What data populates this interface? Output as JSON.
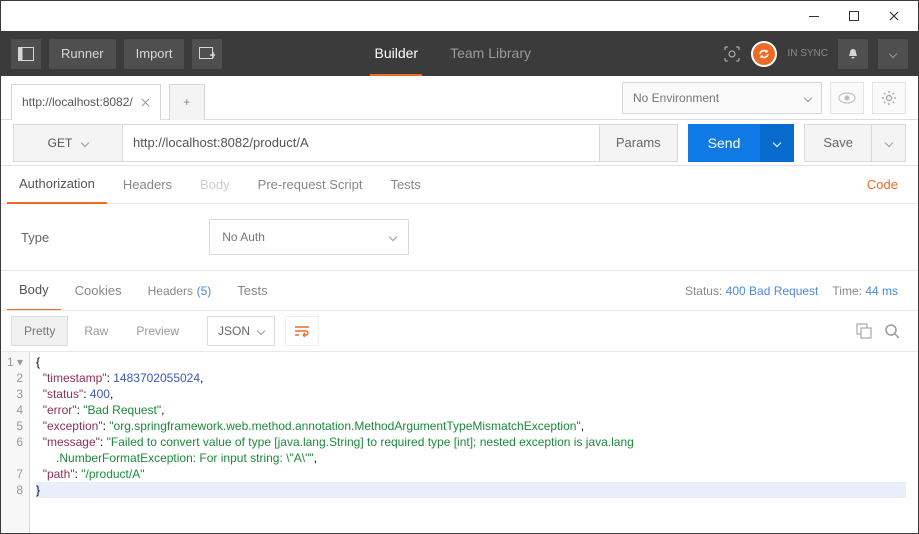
{
  "titlebar": {
    "min": "—"
  },
  "topbar": {
    "runner": "Runner",
    "import": "Import",
    "builder": "Builder",
    "teamlib": "Team Library",
    "insync": "IN SYNC"
  },
  "env": {
    "label": "No Environment"
  },
  "req": {
    "tab": "http://localhost:8082/",
    "method": "GET",
    "url": "http://localhost:8082/product/A",
    "params": "Params",
    "send": "Send",
    "save": "Save"
  },
  "subtabs": {
    "auth": "Authorization",
    "headers": "Headers",
    "body": "Body",
    "prereq": "Pre-request Script",
    "tests": "Tests",
    "code": "Code"
  },
  "auth": {
    "type": "Type",
    "noauth": "No Auth"
  },
  "resp": {
    "body": "Body",
    "cookies": "Cookies",
    "headers": "Headers",
    "hcount": "(5)",
    "tests": "Tests",
    "statusLabel": "Status:",
    "statusVal": "400 Bad Request",
    "timeLabel": "Time:",
    "timeVal": "44 ms"
  },
  "view": {
    "pretty": "Pretty",
    "raw": "Raw",
    "preview": "Preview",
    "fmt": "JSON"
  },
  "json": {
    "ts_k": "\"timestamp\"",
    "ts_v": "1483702055024",
    "st_k": "\"status\"",
    "st_v": "400",
    "er_k": "\"error\"",
    "er_v": "\"Bad Request\"",
    "ex_k": "\"exception\"",
    "ex_v": "\"org.springframework.web.method.annotation.MethodArgumentTypeMismatchException\"",
    "ms_k": "\"message\"",
    "ms_v": "\"Failed to convert value of type [java.lang.String] to required type [int]; nested exception is java.lang",
    "ms_v2": ".NumberFormatException: For input string: \\\"A\\\"\"",
    "pa_k": "\"path\"",
    "pa_v": "\"/product/A\""
  },
  "lines": [
    "1 ▾",
    "2",
    "3",
    "4",
    "5",
    "6",
    "7",
    "8"
  ]
}
